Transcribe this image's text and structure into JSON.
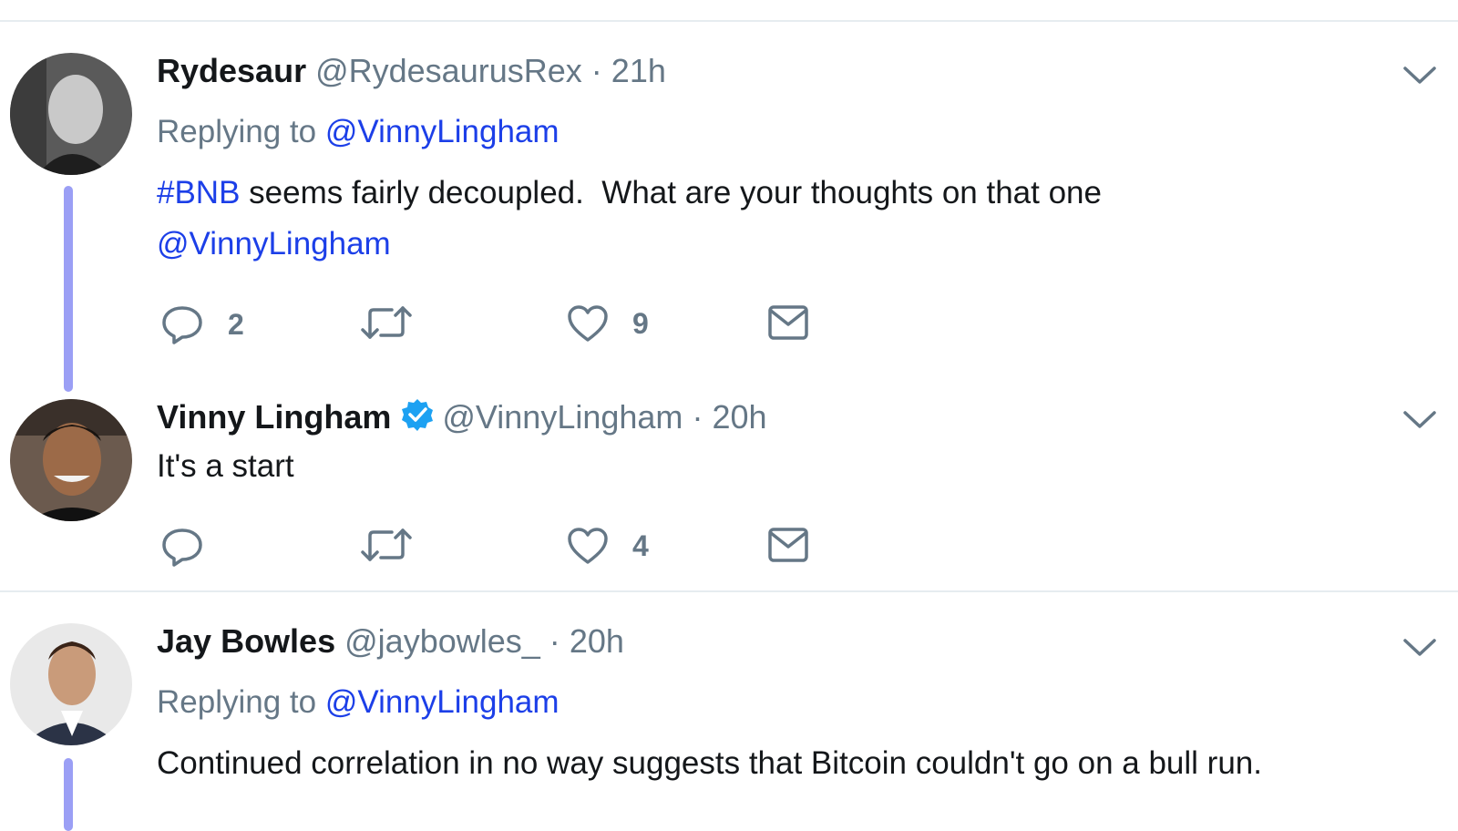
{
  "tweets": [
    {
      "name": "Rydesaur",
      "handle": "@RydesaurusRex",
      "separator": "·",
      "time": "21h",
      "replying_prefix": "Replying to",
      "replying_to": "@VinnyLingham",
      "text_hashtag": "#BNB",
      "text_body": " seems fairly decoupled.  What are your thoughts on that one",
      "text_mention": "@VinnyLingham",
      "reply_count": "2",
      "retweet_count": "",
      "like_count": "9"
    },
    {
      "name": "Vinny Lingham",
      "verified": true,
      "handle": "@VinnyLingham",
      "separator": "·",
      "time": "20h",
      "text": "It's a start",
      "reply_count": "",
      "retweet_count": "",
      "like_count": "4"
    },
    {
      "name": "Jay Bowles",
      "handle": "@jaybowles_",
      "separator": "·",
      "time": "20h",
      "replying_prefix": "Replying to",
      "replying_to": "@VinnyLingham",
      "text": "Continued correlation in no way suggests that Bitcoin couldn't go on a bull run."
    }
  ],
  "colors": {
    "link": "#1c3fe8",
    "muted": "#657786",
    "thread_line": "#9b9ff5",
    "verified": "#1da1f2"
  },
  "icons": {
    "reply": "reply-icon",
    "retweet": "retweet-icon",
    "like": "heart-icon",
    "dm": "envelope-icon",
    "menu": "chevron-down-icon",
    "verified": "verified-badge-icon"
  }
}
